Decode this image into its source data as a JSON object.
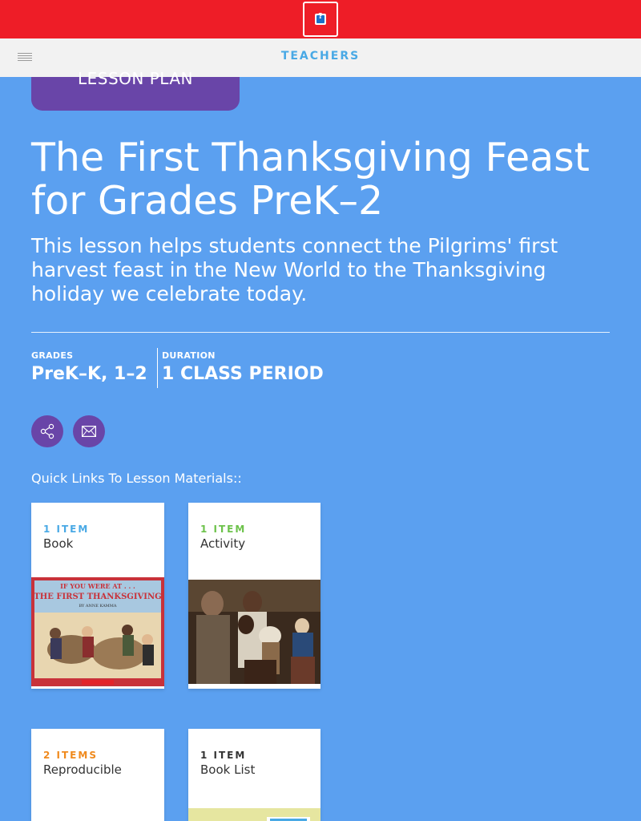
{
  "header": {
    "logo_icon": "scholastic-logo-icon",
    "nav_title": "TEACHERS",
    "menu_icon": "hamburger-menu-icon"
  },
  "lesson": {
    "badge": "LESSON PLAN",
    "title": "The First Thanksgiving Feast for Grades PreK–2",
    "description": "This lesson helps students connect the Pilgrims' first harvest feast in the New World to the Thanksgiving holiday we celebrate today."
  },
  "meta": {
    "grades_label": "GRADES",
    "grades_value": "PreK–K, 1–2",
    "duration_label": "DURATION",
    "duration_value": "1 CLASS PERIOD"
  },
  "actions": {
    "share_icon": "share-icon",
    "email_icon": "mail-icon"
  },
  "quick_links": {
    "heading": "Quick Links To Lesson Materials::",
    "cards": [
      {
        "count": "1 ITEM",
        "type": "Book",
        "count_color": "#49a9e5"
      },
      {
        "count": "1 ITEM",
        "type": "Activity",
        "count_color": "#6cc24a"
      },
      {
        "count": "2 ITEMS",
        "type": "Reproducible",
        "count_color": "#f08a1d"
      },
      {
        "count": "1 ITEM",
        "type": "Book List",
        "count_color": "#333333"
      }
    ]
  },
  "colors": {
    "topbar": "#ee1d27",
    "page_background": "#5ba0f0",
    "accent_purple": "#6945a8",
    "nav_text": "#49a9e5"
  }
}
